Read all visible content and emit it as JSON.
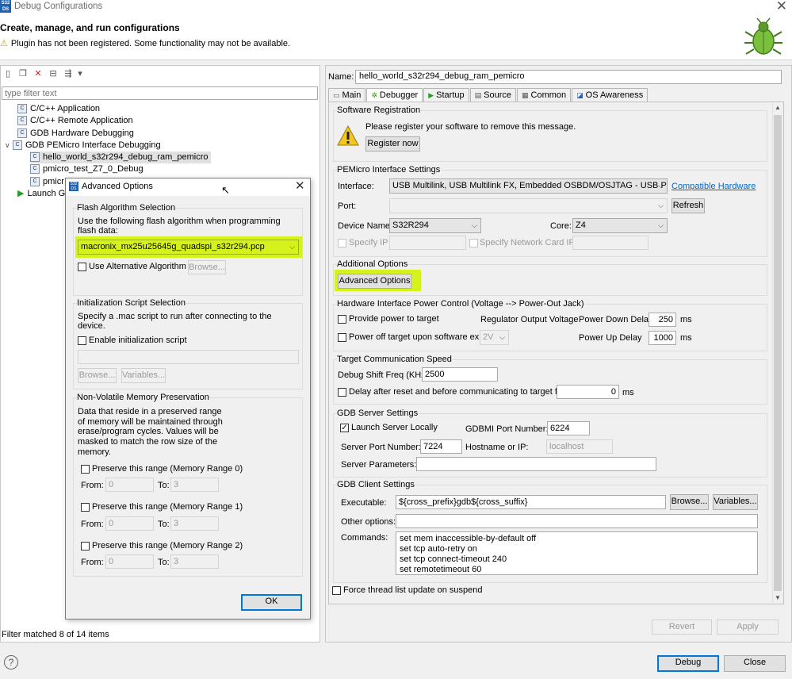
{
  "window": {
    "title": "Debug Configurations",
    "icon_text": "S32 DS"
  },
  "header": {
    "heading": "Create, manage, and run configurations",
    "warning": "Plugin has not been registered. Some functionality may not be available."
  },
  "left": {
    "filter_placeholder": "type filter text",
    "tree": [
      {
        "label": "C/C++ Application"
      },
      {
        "label": "C/C++ Remote Application"
      },
      {
        "label": "GDB Hardware Debugging"
      },
      {
        "label": "GDB PEMicro Interface Debugging"
      },
      {
        "label": "hello_world_s32r294_debug_ram_pemicro"
      },
      {
        "label": "pmicro_test_Z7_0_Debug"
      },
      {
        "label": "pmicr"
      },
      {
        "label": "Launch G"
      }
    ],
    "filter_status": "Filter matched 8 of 14 items"
  },
  "right": {
    "name_label": "Name:",
    "name_value": "hello_world_s32r294_debug_ram_pemicro",
    "tabs": [
      "Main",
      "Debugger",
      "Startup",
      "Source",
      "Common",
      "OS Awareness"
    ],
    "software_registration": {
      "title": "Software Registration",
      "message": "Please register your software to remove this message.",
      "register_button": "Register now"
    },
    "pemicro": {
      "title": "PEMicro Interface Settings",
      "interface_label": "Interface:",
      "interface_value": "USB Multilink, USB Multilink FX, Embedded OSBDM/OSJTAG - USB Port",
      "compatible_link": "Compatible Hardware",
      "port_label": "Port:",
      "refresh_button": "Refresh",
      "device_label": "Device Name:",
      "device_value": "S32R294",
      "core_label": "Core:",
      "core_value": "Z4",
      "specify_ip": "Specify IP",
      "specify_nic": "Specify Network Card IP"
    },
    "additional": {
      "title": "Additional Options",
      "button": "Advanced Options"
    },
    "power": {
      "title": "Hardware Interface Power Control (Voltage --> Power-Out Jack)",
      "provide_power": "Provide power to target",
      "regulator_label": "Regulator Output Voltage",
      "power_off": "Power off target upon software exit",
      "voltage_value": "2V",
      "down_delay_label": "Power Down Delay",
      "down_delay_value": "250",
      "up_delay_label": "Power Up Delay",
      "up_delay_value": "1000",
      "unit": "ms"
    },
    "speed": {
      "title": "Target Communication Speed",
      "shift_label": "Debug Shift Freq (KHz)",
      "shift_value": "2500",
      "delay_label": "Delay after reset and before communicating to target for",
      "delay_value": "0",
      "unit": "ms"
    },
    "gdb_server": {
      "title": "GDB Server Settings",
      "launch_locally": "Launch Server Locally",
      "gdbmi_label": "GDBMI Port Number:",
      "gdbmi_value": "6224",
      "server_port_label": "Server Port Number:",
      "server_port_value": "7224",
      "hostname_label": "Hostname or IP:",
      "hostname_value": "localhost",
      "params_label": "Server Parameters:"
    },
    "gdb_client": {
      "title": "GDB Client Settings",
      "executable_label": "Executable:",
      "executable_value": "${cross_prefix}gdb${cross_suffix}",
      "browse_button": "Browse...",
      "variables_button": "Variables...",
      "other_label": "Other options:",
      "commands_label": "Commands:",
      "commands": [
        "set mem inaccessible-by-default off",
        "set tcp auto-retry on",
        "set tcp connect-timeout 240",
        "set remotetimeout 60"
      ]
    },
    "force_thread": "Force thread list update on suspend"
  },
  "dialog": {
    "title": "Advanced Options",
    "flash": {
      "title": "Flash Algorithm Selection",
      "desc": "Use the following flash algorithm when programming flash data:",
      "algo_value": "macronix_mx25u25645g_quadspi_s32r294.pcp",
      "use_alt": "Use Alternative Algorithm",
      "browse": "Browse..."
    },
    "init": {
      "title": "Initialization Script Selection",
      "desc": "Specify a .mac script to run after connecting to the device.",
      "enable": "Enable initialization script",
      "browse": "Browse...",
      "variables": "Variables..."
    },
    "nvm": {
      "title": "Non-Volatile Memory Preservation",
      "desc": "Data that reside in a preserved range of memory will be maintained through erase/program cycles. Values will be masked to match the row size of the memory.",
      "from_label": "From:",
      "to_label": "To:",
      "ranges": [
        {
          "label": "Preserve this range (Memory Range 0)",
          "from": "0",
          "to": "3"
        },
        {
          "label": "Preserve this range (Memory Range 1)",
          "from": "0",
          "to": "3"
        },
        {
          "label": "Preserve this range (Memory Range 2)",
          "from": "0",
          "to": "3"
        }
      ]
    },
    "ok": "OK"
  },
  "buttons": {
    "revert": "Revert",
    "apply": "Apply",
    "debug": "Debug",
    "close": "Close"
  },
  "colors": {
    "highlight": "#d6f21c",
    "accent": "#0078d7",
    "link": "#0066cc"
  }
}
